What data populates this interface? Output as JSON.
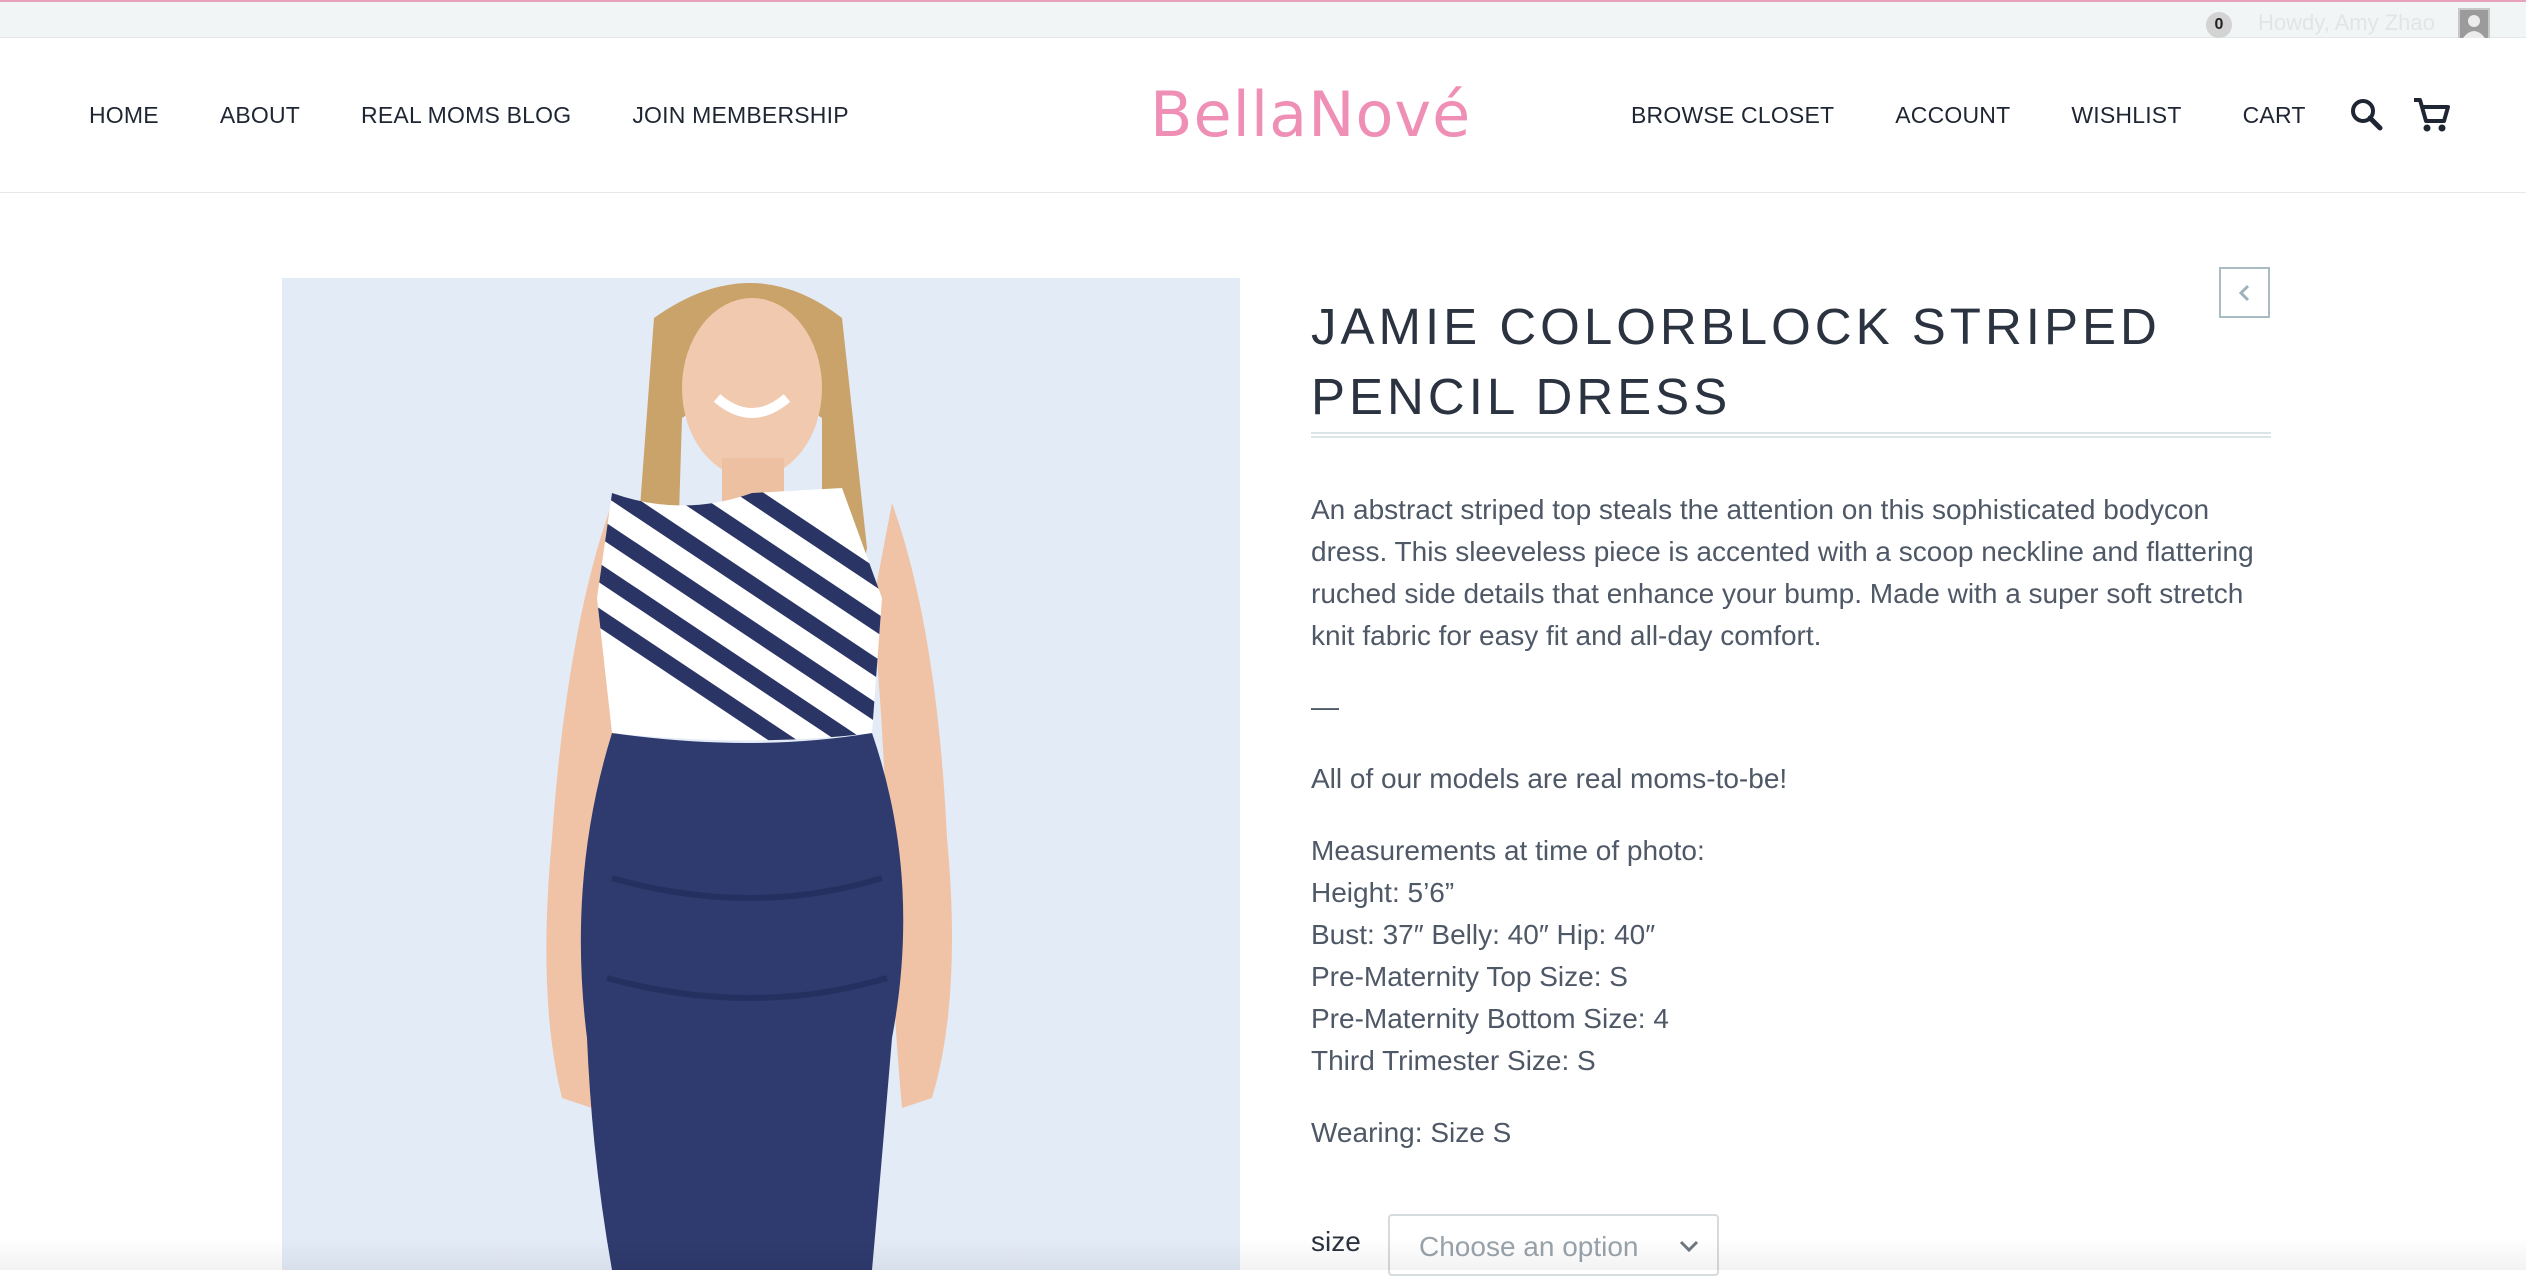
{
  "admin_bar": {
    "cart_count": "0",
    "greeting": "Howdy, Amy Zhao"
  },
  "header": {
    "logo": "BellaNové",
    "nav_left": [
      "HOME",
      "ABOUT",
      "REAL MOMS BLOG",
      "JOIN MEMBERSHIP"
    ],
    "nav_right": [
      "BROWSE CLOSET",
      "ACCOUNT",
      "WISHLIST",
      "CART"
    ],
    "icons": [
      "search-icon",
      "cart-icon"
    ]
  },
  "product": {
    "title": "JAMIE COLORBLOCK STRIPED PENCIL DRESS",
    "description": "An abstract striped top steals the attention on this sophisticated bodycon dress. This sleeveless piece is accented with a scoop neckline and flattering ruched side details that enhance your bump. Made with a super soft stretch knit fabric for easy fit and all-day comfort.",
    "separator": "—",
    "models_note": "All of our models are real moms-to-be!",
    "measurements": [
      "Measurements at time of photo:",
      "Height: 5’6”",
      "Bust: 37″ Belly: 40″ Hip: 40″",
      "Pre-Maternity Top Size: S",
      "Pre-Maternity Bottom Size: 4",
      "Third Trimester Size: S"
    ],
    "wearing": "Wearing: Size S",
    "size_label": "size",
    "size_placeholder": "Choose an option"
  },
  "colors": {
    "brand_pink": "#ef8fb6",
    "text_dark": "#1f2633",
    "dress_navy": "#2f3a6e",
    "background_photo": "#e3ebf7"
  }
}
